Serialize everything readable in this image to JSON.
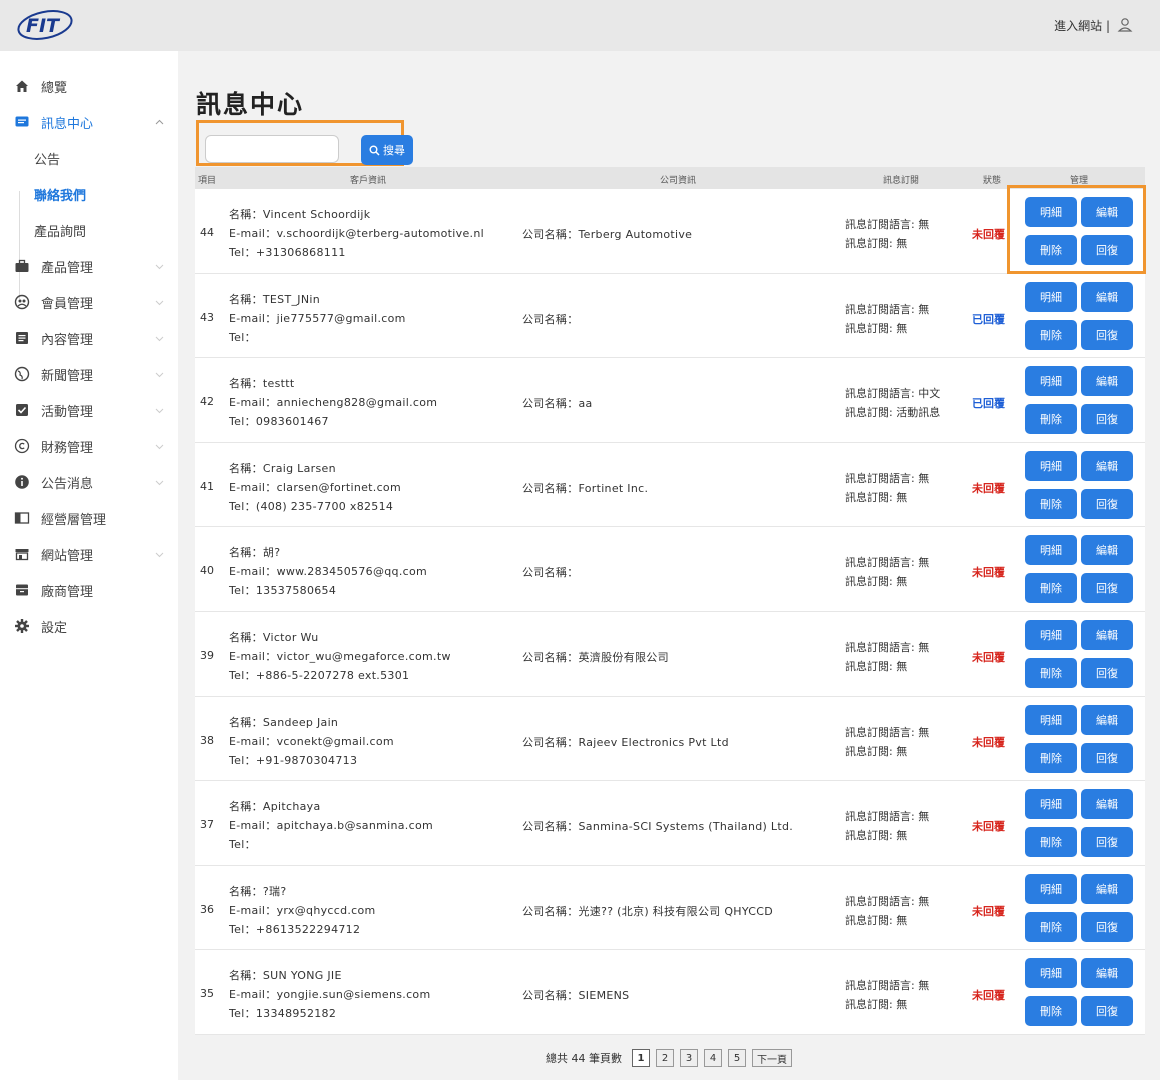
{
  "topbar": {
    "logo_text": "FIT",
    "site_link": "進入網站 |"
  },
  "sidebar": {
    "items": [
      {
        "label": "總覽",
        "icon": "home-icon"
      },
      {
        "label": "訊息中心",
        "icon": "message-icon"
      },
      {
        "label": "公告",
        "icon": ""
      },
      {
        "label": "聯絡我們",
        "icon": ""
      },
      {
        "label": "產品詢問",
        "icon": ""
      },
      {
        "label": "產品管理",
        "icon": "briefcase-icon"
      },
      {
        "label": "會員管理",
        "icon": "members-icon"
      },
      {
        "label": "內容管理",
        "icon": "document-icon"
      },
      {
        "label": "新聞管理",
        "icon": "globe-icon"
      },
      {
        "label": "活動管理",
        "icon": "checkbox-icon"
      },
      {
        "label": "財務管理",
        "icon": "copyright-icon"
      },
      {
        "label": "公告消息",
        "icon": "info-icon"
      },
      {
        "label": "經營層管理",
        "icon": "panel-icon"
      },
      {
        "label": "網站管理",
        "icon": "store-icon"
      },
      {
        "label": "廠商管理",
        "icon": "archive-icon"
      },
      {
        "label": "設定",
        "icon": "gear-icon"
      }
    ]
  },
  "main": {
    "title": "訊息中心",
    "search": {
      "value": "",
      "button_label": "搜尋"
    },
    "headers": {
      "item": "項目",
      "customer": "客戶資訊",
      "company": "公司資訊",
      "subscription": "訊息訂閱",
      "status": "狀態",
      "manage": "管理"
    },
    "buttons": {
      "detail": "明細",
      "edit": "編輯",
      "delete": "刪除",
      "reply": "回復"
    },
    "rows": [
      {
        "no": "44",
        "name": "名稱：Vincent Schoordijk",
        "email": "E-mail：v.schoordijk@terberg-automotive.nl",
        "tel": "Tel：+31306868111",
        "company": "公司名稱：Terberg Automotive",
        "sub_lang": "訊息訂閱語言: 無",
        "sub": "訊息訂閱: 無",
        "status": "未回覆",
        "status_type": "red"
      },
      {
        "no": "43",
        "name": "名稱：TEST_JNin",
        "email": "E-mail：jie775577@gmail.com",
        "tel": "Tel：",
        "company": "公司名稱：",
        "sub_lang": "訊息訂閱語言: 無",
        "sub": "訊息訂閱: 無",
        "status": "已回覆",
        "status_type": "blue"
      },
      {
        "no": "42",
        "name": "名稱：testtt",
        "email": "E-mail：anniecheng828@gmail.com",
        "tel": "Tel：0983601467",
        "company": "公司名稱：aa",
        "sub_lang": "訊息訂閱語言: 中文",
        "sub": "訊息訂閱: 活動訊息",
        "status": "已回覆",
        "status_type": "blue"
      },
      {
        "no": "41",
        "name": "名稱：Craig Larsen",
        "email": "E-mail：clarsen@fortinet.com",
        "tel": "Tel：(408) 235-7700 x82514",
        "company": "公司名稱：Fortinet Inc.",
        "sub_lang": "訊息訂閱語言: 無",
        "sub": "訊息訂閱: 無",
        "status": "未回覆",
        "status_type": "red"
      },
      {
        "no": "40",
        "name": "名稱：胡?",
        "email": "E-mail：www.283450576@qq.com",
        "tel": "Tel：13537580654",
        "company": "公司名稱：",
        "sub_lang": "訊息訂閱語言: 無",
        "sub": "訊息訂閱: 無",
        "status": "未回覆",
        "status_type": "red"
      },
      {
        "no": "39",
        "name": "名稱：Victor Wu",
        "email": "E-mail：victor_wu@megaforce.com.tw",
        "tel": "Tel：+886-5-2207278 ext.5301",
        "company": "公司名稱：英濟股份有限公司",
        "sub_lang": "訊息訂閱語言: 無",
        "sub": "訊息訂閱: 無",
        "status": "未回覆",
        "status_type": "red"
      },
      {
        "no": "38",
        "name": "名稱：Sandeep Jain",
        "email": "E-mail：vconekt@gmail.com",
        "tel": "Tel：+91-9870304713",
        "company": "公司名稱：Rajeev Electronics Pvt Ltd",
        "sub_lang": "訊息訂閱語言: 無",
        "sub": "訊息訂閱: 無",
        "status": "未回覆",
        "status_type": "red"
      },
      {
        "no": "37",
        "name": "名稱：Apitchaya",
        "email": "E-mail：apitchaya.b@sanmina.com",
        "tel": "Tel：",
        "company": "公司名稱：Sanmina-SCI Systems (Thailand) Ltd.",
        "sub_lang": "訊息訂閱語言: 無",
        "sub": "訊息訂閱: 無",
        "status": "未回覆",
        "status_type": "red"
      },
      {
        "no": "36",
        "name": "名稱：?瑞?",
        "email": "E-mail：yrx@qhyccd.com",
        "tel": "Tel：+8613522294712",
        "company": "公司名稱：光速?? (北京) 科技有限公司 QHYCCD",
        "sub_lang": "訊息訂閱語言: 無",
        "sub": "訊息訂閱: 無",
        "status": "未回覆",
        "status_type": "red"
      },
      {
        "no": "35",
        "name": "名稱：SUN YONG JIE",
        "email": "E-mail：yongjie.sun@siemens.com",
        "tel": "Tel：13348952182",
        "company": "公司名稱：SIEMENS",
        "sub_lang": "訊息訂閱語言: 無",
        "sub": "訊息訂閱: 無",
        "status": "未回覆",
        "status_type": "red"
      }
    ],
    "pagination": {
      "total": "總共 44 筆頁數",
      "pages": [
        "1",
        "2",
        "3",
        "4",
        "5"
      ],
      "current": "1",
      "next": "下一頁"
    }
  },
  "colors": {
    "accent": "#2a7de1",
    "highlight": "#f0952f",
    "unreplied": "#d7261e",
    "replied": "#1e5fd6"
  }
}
